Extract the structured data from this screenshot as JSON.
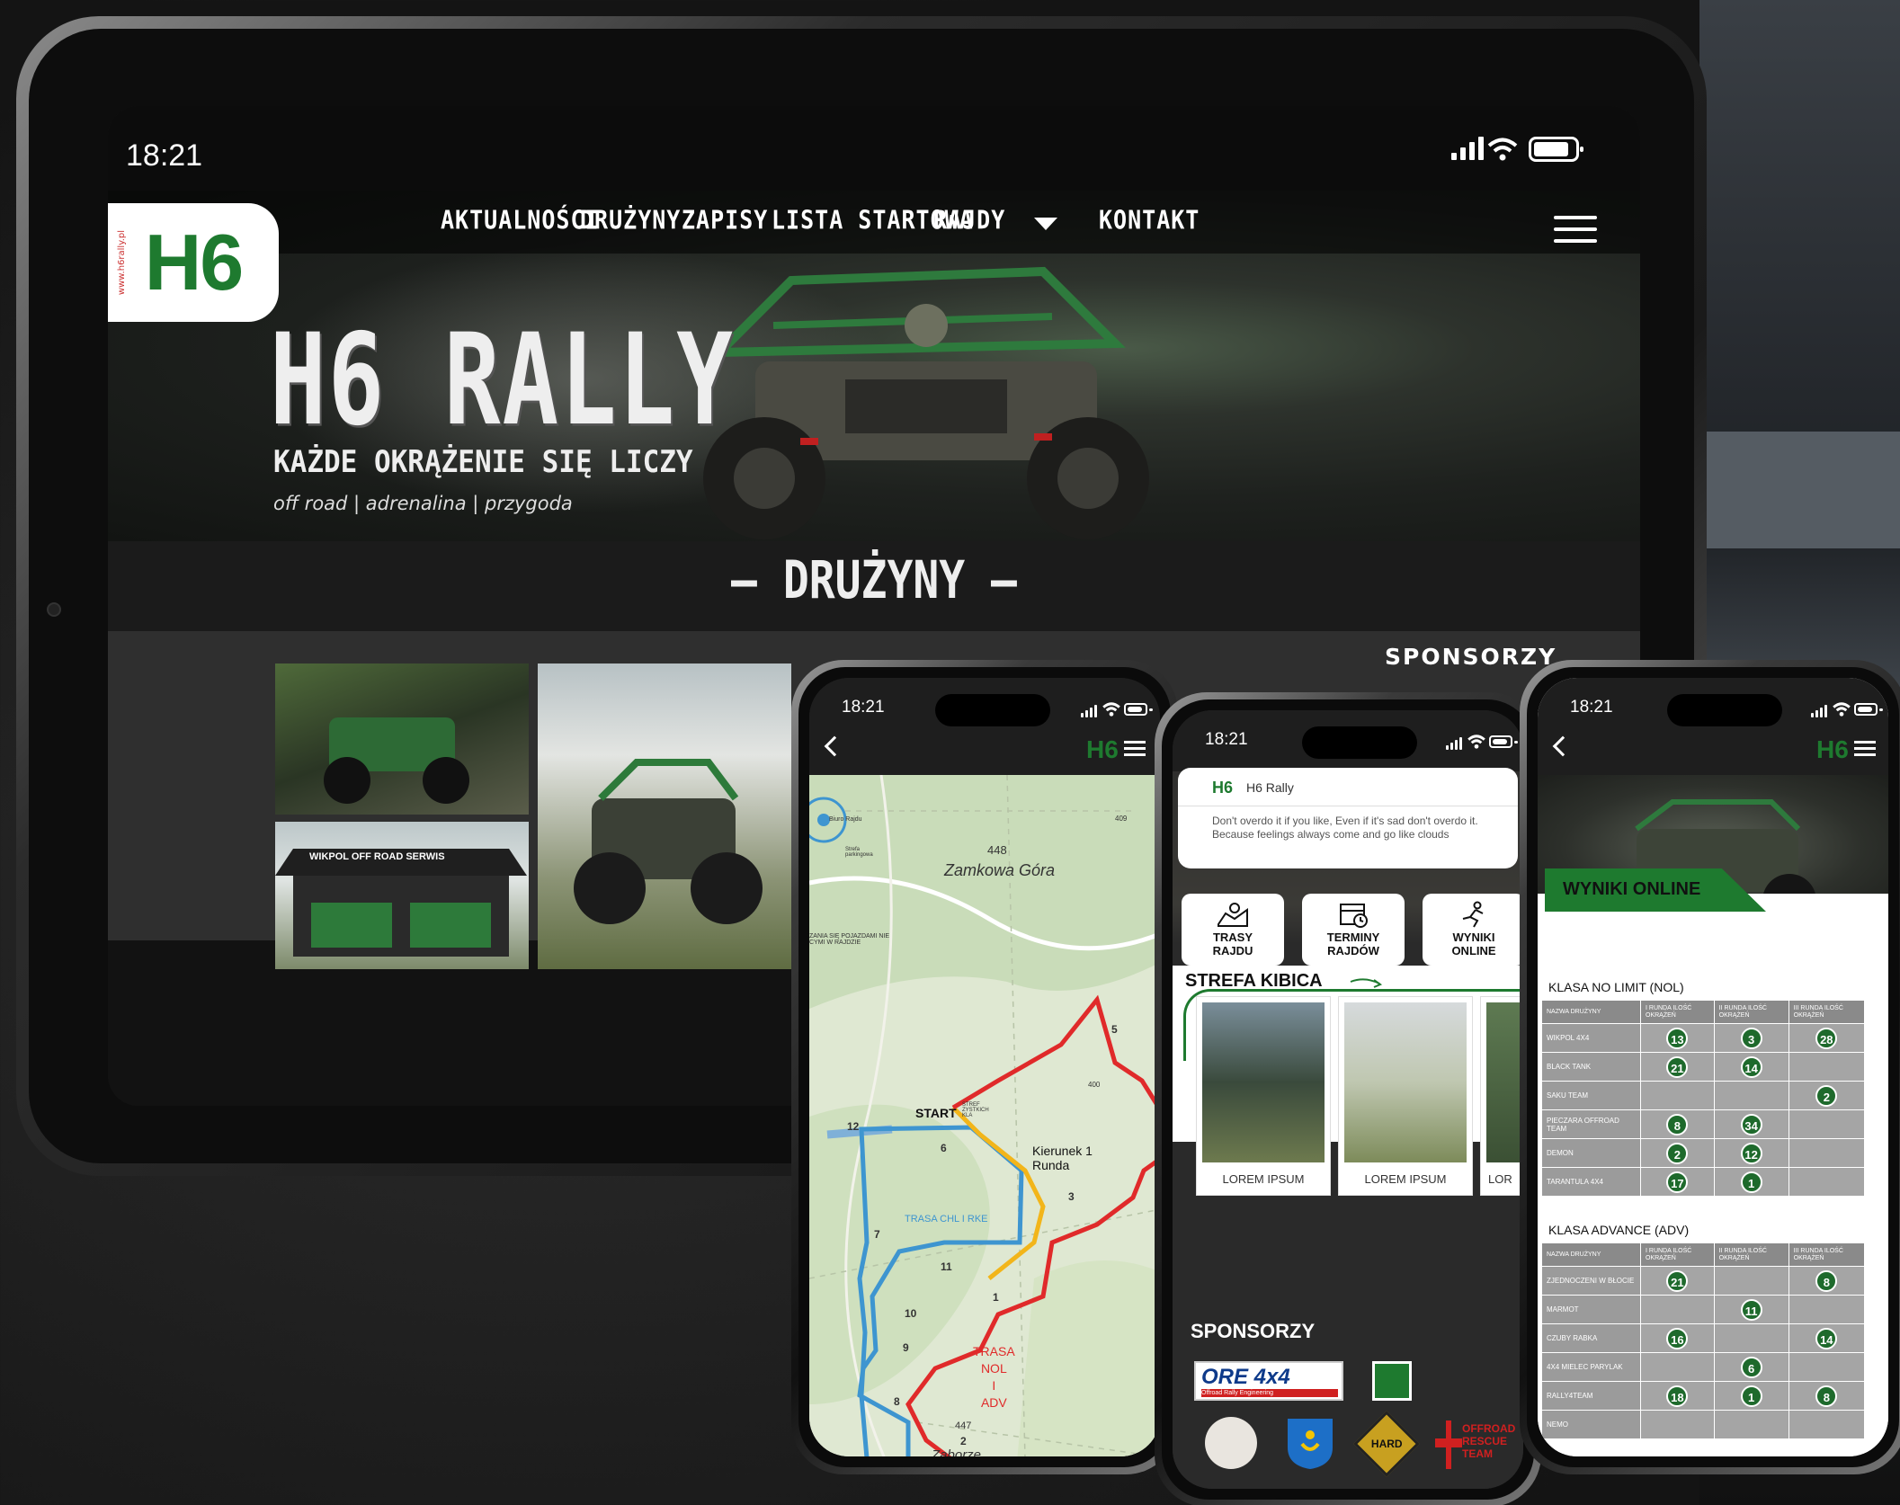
{
  "status": {
    "time": "18:21"
  },
  "tablet": {
    "logo": "H6",
    "logo_url": "www.h6rally.pl",
    "nav": [
      "AKTUALNOŚCI",
      "DRUŻYNY",
      "ZAPISY",
      "LISTA STARTOWA",
      "RAJDY",
      "KONTAKT"
    ],
    "hero_title": "H6 RALLY",
    "hero_subtitle": "KAŻDE OKRĄŻENIE SIĘ LICZY",
    "hero_tagline": "off road | adrenalina | przygoda",
    "section_title": "— DRUŻYNY —",
    "sponsors_heading": "SPONSORZY",
    "tent_banner": "WIKPOL OFF ROAD SERWIS"
  },
  "map_phone": {
    "brand": "H6",
    "labels": {
      "biuro": "Biuro Rajdu",
      "strefa": "Strefa parkingowa",
      "elevation": "448",
      "place": "Zamkowa Góra",
      "warning": "ZANIA SIĘ POJAZDAMI NIE\nCYMI W RAJDZIE",
      "start": "START",
      "start_sub": "STREF\nZYSTKICH\nKLA",
      "kierunek": "Kierunek 1\nRunda",
      "trasa_blue": "TRASA CHL I RKE",
      "trasa_red": "TRASA\nNOL\nI\nADV",
      "el447": "447",
      "town": "Zaborze",
      "el409": "409",
      "el400": "400",
      "checkpoints": [
        "1",
        "2",
        "3",
        "5",
        "6",
        "7",
        "8",
        "9",
        "10",
        "11",
        "12"
      ]
    }
  },
  "home_phone": {
    "brand": "H6",
    "notification": {
      "app": "H6 Rally",
      "text": "Don't overdo it if you like, Even if it's sad don't overdo it. Because feelings always come and go like clouds"
    },
    "cards": [
      {
        "label": "TRASY RAJDU",
        "icon": "map-route-icon"
      },
      {
        "label": "TERMINY RAJDÓW",
        "icon": "calendar-clock-icon"
      },
      {
        "label": "WYNIKI ONLINE",
        "icon": "runner-icon"
      }
    ],
    "strefa": "STREFA KIBICA",
    "photos": [
      "LOREM IPSUM",
      "LOREM IPSUM",
      "LOR"
    ],
    "sponsors_heading": "SPONSORZY",
    "sponsor_main": "ORE 4x4",
    "sponsor_main_sub": "Offroad Rally Engineering",
    "sponsor_hard": "HARD",
    "sponsor_rescue": "OFFROAD RESCUE TEAM"
  },
  "results_phone": {
    "brand": "H6",
    "title": "WYNIKI ONLINE",
    "headers": [
      "NAZWA DRUŻYNY",
      "I RUNDA ILOŚĆ OKRĄŻEŃ",
      "II RUNDA ILOŚĆ OKRĄŻEŃ",
      "III RUNDA ILOŚĆ OKRĄŻEŃ"
    ],
    "classes": [
      {
        "name": "KLASA NO LIMIT (NOL)",
        "rows": [
          {
            "team": "WIKPOL 4X4",
            "r1": "13",
            "r2": "3",
            "r3": "28"
          },
          {
            "team": "BLACK TANK",
            "r1": "21",
            "r2": "14",
            "r3": ""
          },
          {
            "team": "SAKU TEAM",
            "r1": "",
            "r2": "",
            "r3": "2"
          },
          {
            "team": "PIECZARA OFFROAD TEAM",
            "r1": "8",
            "r2": "34",
            "r3": ""
          },
          {
            "team": "DEMON",
            "r1": "2",
            "r2": "12",
            "r3": ""
          },
          {
            "team": "TARANTULA 4X4",
            "r1": "17",
            "r2": "1",
            "r3": ""
          }
        ]
      },
      {
        "name": "KLASA ADVANCE (ADV)",
        "rows": [
          {
            "team": "ZJEDNOCZENI W BŁOCIE",
            "r1": "21",
            "r2": "",
            "r3": "8"
          },
          {
            "team": "MARMOT",
            "r1": "",
            "r2": "11",
            "r3": ""
          },
          {
            "team": "CZUBY RABKA",
            "r1": "16",
            "r2": "",
            "r3": "14"
          },
          {
            "team": "4X4 MIELEC PARYLAK",
            "r1": "",
            "r2": "6",
            "r3": ""
          },
          {
            "team": "RALLY4TEAM",
            "r1": "18",
            "r2": "1",
            "r3": "8"
          },
          {
            "team": "NEMO",
            "r1": "",
            "r2": "",
            "r3": ""
          }
        ]
      }
    ]
  },
  "colors": {
    "brand_green": "#1e7a2f",
    "dark": "#1b1b1b"
  }
}
